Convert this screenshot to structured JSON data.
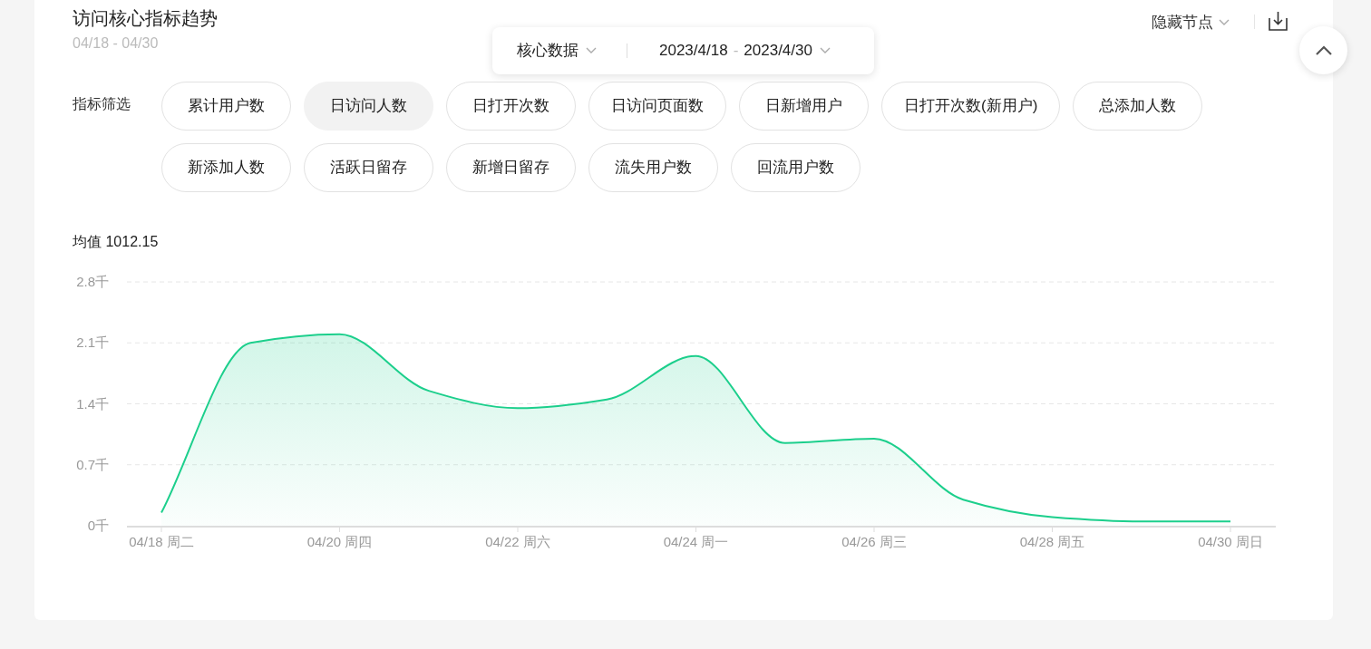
{
  "header": {
    "title": "访问核心指标趋势",
    "date_hint": "04/18 - 04/30"
  },
  "toolbar": {
    "dataset": "核心数据",
    "date_range": {
      "start": "2023/4/18",
      "separator": "-",
      "end": "2023/4/30"
    }
  },
  "actions": {
    "hide_nodes": "隐藏节点"
  },
  "filter": {
    "label": "指标筛选",
    "options": [
      {
        "label": "累计用户数",
        "selected": false
      },
      {
        "label": "日访问人数",
        "selected": true
      },
      {
        "label": "日打开次数",
        "selected": false
      },
      {
        "label": "日访问页面数",
        "selected": false
      },
      {
        "label": "日新增用户",
        "selected": false
      },
      {
        "label": "日打开次数(新用户)",
        "selected": false
      },
      {
        "label": "总添加人数",
        "selected": false
      },
      {
        "label": "新添加人数",
        "selected": false
      },
      {
        "label": "活跃日留存",
        "selected": false
      },
      {
        "label": "新增日留存",
        "selected": false
      },
      {
        "label": "流失用户数",
        "selected": false
      },
      {
        "label": "回流用户数",
        "selected": false
      }
    ]
  },
  "average": {
    "label": "均值",
    "value": "1012.15"
  },
  "chart": {
    "chart_data": {
      "type": "area",
      "categories": [
        "04/18 周二",
        null,
        "04/20 周四",
        null,
        "04/22 周六",
        null,
        "04/24 周一",
        null,
        "04/26 周三",
        null,
        "04/28 周五",
        null,
        "04/30 周日"
      ],
      "values": [
        0.15,
        2.1,
        2.2,
        1.55,
        1.35,
        1.45,
        1.95,
        0.95,
        1.0,
        0.3,
        0.1,
        0.05,
        0.05
      ],
      "ylim": [
        0,
        2.8
      ],
      "grid": true,
      "yticks": [
        {
          "value": 0,
          "label": "0千"
        },
        {
          "value": 0.7,
          "label": "0.7千"
        },
        {
          "value": 1.4,
          "label": "1.4千"
        },
        {
          "value": 2.1,
          "label": "2.1千"
        },
        {
          "value": 2.8,
          "label": "2.8千"
        }
      ]
    }
  }
}
